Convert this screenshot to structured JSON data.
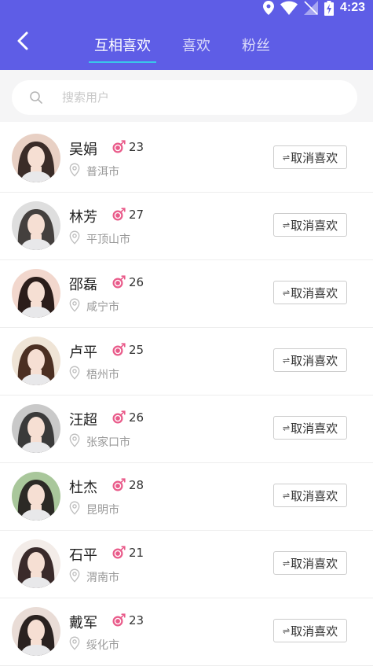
{
  "status_bar": {
    "time": "4:23"
  },
  "tabs": [
    {
      "label": "互相喜欢",
      "active": true
    },
    {
      "label": "喜欢",
      "active": false
    },
    {
      "label": "粉丝",
      "active": false
    }
  ],
  "search": {
    "placeholder": "搜索用户",
    "value": ""
  },
  "unlike_label": "取消喜欢",
  "users": [
    {
      "name": "吴娟",
      "age": "23",
      "city": "普洱市",
      "avatar": [
        "#e8d0c4",
        "#3a2c28"
      ]
    },
    {
      "name": "林芳",
      "age": "27",
      "city": "平顶山市",
      "avatar": [
        "#dedede",
        "#44403e"
      ]
    },
    {
      "name": "邵磊",
      "age": "26",
      "city": "咸宁市",
      "avatar": [
        "#f2d7cd",
        "#2b1d1a"
      ]
    },
    {
      "name": "卢平",
      "age": "25",
      "city": "梧州市",
      "avatar": [
        "#efe4d6",
        "#4b2f22"
      ]
    },
    {
      "name": "汪超",
      "age": "26",
      "city": "张家口市",
      "avatar": [
        "#c9c9c9",
        "#3a3a3a"
      ]
    },
    {
      "name": "杜杰",
      "age": "28",
      "city": "昆明市",
      "avatar": [
        "#a9c79b",
        "#2c2a26"
      ]
    },
    {
      "name": "石平",
      "age": "21",
      "city": "渭南市",
      "avatar": [
        "#f3ece8",
        "#3a2a2a"
      ]
    },
    {
      "name": "戴军",
      "age": "23",
      "city": "绥化市",
      "avatar": [
        "#e9dcd6",
        "#2a2220"
      ]
    }
  ],
  "colors": {
    "header": "#5e5de6",
    "tab_indicator": "#39c6ea",
    "gender_female": "#e95b8a"
  }
}
